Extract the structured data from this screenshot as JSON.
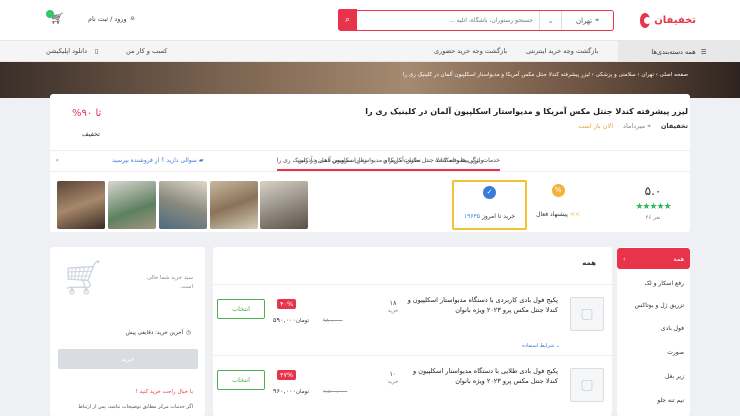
{
  "header": {
    "logo_text": "تخفیفان",
    "search": {
      "placeholder": "جستجو رستوران، باشگاه، آتلیه ...",
      "city": "تهران",
      "button_icon": "search-icon"
    },
    "login_label": "ورود / ثبت نام",
    "cart_count": "۰"
  },
  "nav": {
    "all_categories": "همه دسته‌بندی‌ها",
    "items": [
      "بازگشت وجه خرید اینترنتی",
      "بازگشت وجه خرید حضوری",
      "کسب و کار من",
      "دانلود اپلیکیشن"
    ]
  },
  "breadcrumb": "صفحه اصلی › تهران › سلامتی و پزشکی › لیزر پیشرفته کندلا جنتل مکس آمریکا و مدیواستار اسکلپیون آلمان در کلینیک ری را",
  "product": {
    "title": "لیزر پیشرفته کندلا جنتل مکس آمریکا و مدیواستار اسکلپیون آلمان در کلینیک ری را",
    "vendor_brand": "تخفیفان",
    "location": "میرداماد",
    "status": "الان باز است",
    "discount_prefix": "تا",
    "discount_value": "۹۰%",
    "discount_label": "تخفیف"
  },
  "tabs": [
    "خدمات لیزر پیشرفته کندلا جنتل مکس آمریکا و مدیواستار اسکلپیون آلمان در کلینیک ری را",
    "ویژگی ها و امکانات",
    "نظرات کاربران",
    "زمان سرویس دهی و آدرس",
    "سوالی دارید ؟ از فروشنده بپرسید"
  ],
  "rating": {
    "score": "۵.۰",
    "stars": "★★★★★",
    "count": "۴۶ نفر"
  },
  "offer": {
    "label": "پیشنهاد فعال",
    "arrow": "<<"
  },
  "buy_today": {
    "number": "۱۹۶۳۵",
    "label": "خرید تا امروز"
  },
  "colors": {
    "accent": "#e8344a",
    "green": "#4caf50",
    "blue": "#3b7bd8",
    "yellow": "#f2c230"
  },
  "sidebar": {
    "header": "همه",
    "items": [
      "رفع اسکار و لک",
      "تزریق ژل و بوتاکس",
      "فول بادی",
      "صورت",
      "زیر بغل",
      "نیم تنه جلو"
    ]
  },
  "main": {
    "header": "همه",
    "packages": [
      {
        "title": "پکیج فول بادی کاربردی با دستگاه مدیواستار اسکلپیون و کندلا جنتل مکس پرو ۲۰۲۳ ویژه بانوان",
        "count": "۱۸",
        "count_label": "خرید",
        "discount": "۴۰%",
        "old_price": "۹۸۰,۰۰۰",
        "new_price": "۵۹۰,۰۰۰",
        "currency": "تومان",
        "select_label": "انتخاب",
        "more": "شرایط استفاده ⌄"
      },
      {
        "title": "پکیج فول بادی طلایی با دستگاه مدیواستار اسکلپیون و کندلا جنتل مکس پرو ۲۰۲۳ ویژه بانوان",
        "count": "۱۰",
        "count_label": "خرید",
        "discount": "۴۷%",
        "old_price": "۱,۸۰۰,۰۰۰",
        "new_price": "۹۶۰,۰۰۰",
        "currency": "تومان",
        "select_label": "انتخاب",
        "more": ""
      }
    ]
  },
  "cart": {
    "empty_text": "سبد خرید شما خالی است.",
    "last_buy": "آخرین خرید: دقایقی پیش",
    "buy_button": "خرید",
    "peace_title": "با خیال راحت خرید کنید !",
    "note": "اگر خدمات مرکز مطابق توضیحات نباشد، پس از ارتباط"
  }
}
